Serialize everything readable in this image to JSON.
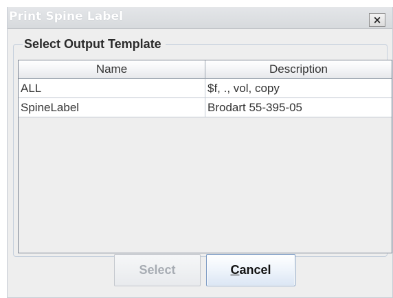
{
  "window": {
    "title": "Print Spine Label",
    "close_glyph": "×"
  },
  "group": {
    "title": "Select Output Template"
  },
  "table": {
    "columns": [
      "Name",
      "Description"
    ],
    "rows": [
      {
        "name": "ALL",
        "description": "$f, ., vol, copy"
      },
      {
        "name": "SpineLabel",
        "description": "Brodart 55-395-05"
      }
    ]
  },
  "buttons": {
    "select_label": "Select",
    "select_enabled": false,
    "cancel_label_mnemonic": "C",
    "cancel_label_rest": "ancel"
  },
  "colors": {
    "dialog_background": "#eeeeee",
    "table_border": "#7d8593",
    "cancel_border": "#7e9cc4",
    "disabled_text": "#a7acb3"
  }
}
